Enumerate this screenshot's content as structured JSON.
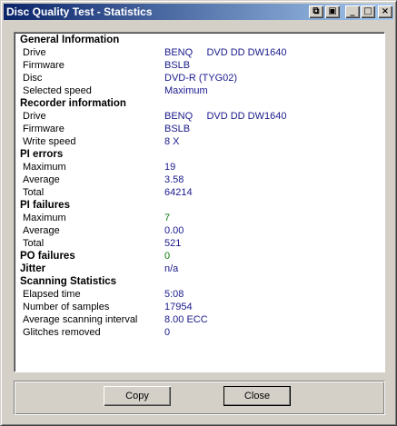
{
  "window": {
    "title": "Disc Quality Test - Statistics"
  },
  "title_buttons": {
    "minimize": "_",
    "maximize": "□",
    "close": "×"
  },
  "stats": [
    {
      "type": "head",
      "label": "General Information"
    },
    {
      "type": "row",
      "label": "Drive",
      "value": "BENQ     DVD DD DW1640"
    },
    {
      "type": "row",
      "label": "Firmware",
      "value": "BSLB"
    },
    {
      "type": "row",
      "label": "Disc",
      "value": "DVD-R (TYG02)"
    },
    {
      "type": "row",
      "label": "Selected speed",
      "value": "Maximum"
    },
    {
      "type": "head",
      "label": "Recorder information"
    },
    {
      "type": "row",
      "label": "Drive",
      "value": "BENQ     DVD DD DW1640"
    },
    {
      "type": "row",
      "label": "Firmware",
      "value": "BSLB"
    },
    {
      "type": "row",
      "label": "Write speed",
      "value": "8 X"
    },
    {
      "type": "head",
      "label": "PI errors"
    },
    {
      "type": "row",
      "label": "Maximum",
      "value": "19"
    },
    {
      "type": "row",
      "label": "Average",
      "value": "3.58"
    },
    {
      "type": "row",
      "label": "Total",
      "value": "64214"
    },
    {
      "type": "head",
      "label": "PI failures"
    },
    {
      "type": "row",
      "label": "Maximum",
      "value": "7",
      "status": "good"
    },
    {
      "type": "row",
      "label": "Average",
      "value": "0.00"
    },
    {
      "type": "row",
      "label": "Total",
      "value": "521"
    },
    {
      "type": "head",
      "label": "PO failures",
      "value": "0",
      "status": "good"
    },
    {
      "type": "head",
      "label": "Jitter",
      "value": "n/a"
    },
    {
      "type": "head",
      "label": "Scanning Statistics"
    },
    {
      "type": "row",
      "label": "Elapsed time",
      "value": "5:08"
    },
    {
      "type": "row",
      "label": "Number of samples",
      "value": "17954"
    },
    {
      "type": "row",
      "label": "Average scanning interval",
      "value": "8.00 ECC"
    },
    {
      "type": "row",
      "label": "Glitches removed",
      "value": "0"
    }
  ],
  "buttons": {
    "copy": "Copy",
    "close": "Close"
  },
  "colors": {
    "value": "#1a1a8c",
    "good": "#0a7a0a",
    "titlebar": "#0a246a"
  }
}
